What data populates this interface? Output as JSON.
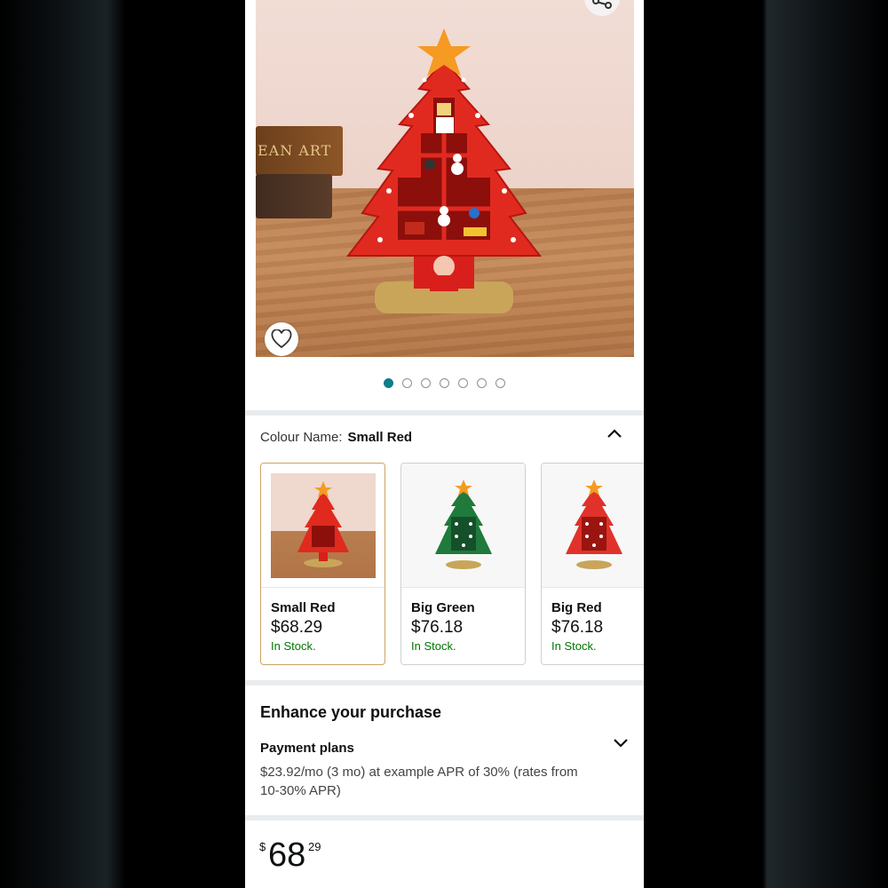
{
  "product_image": {
    "book_spine_text": "EAN ART",
    "share_icon": "share-icon",
    "wishlist_icon": "heart-icon"
  },
  "carousel": {
    "count": 7,
    "active_index": 0
  },
  "colour": {
    "label": "Colour Name:",
    "selected": "Small Red",
    "options": [
      {
        "name": "Small Red",
        "price": "$68.29",
        "stock": "In Stock."
      },
      {
        "name": "Big Green",
        "price": "$76.18",
        "stock": "In Stock."
      },
      {
        "name": "Big Red",
        "price": "$76.18",
        "stock": "In Stock."
      }
    ]
  },
  "enhance": {
    "title": "Enhance your purchase",
    "payment_title": "Payment plans",
    "payment_text": "$23.92/mo (3 mo) at example APR of 30% (rates from 10-30% APR)"
  },
  "price": {
    "currency": "$",
    "whole": "68",
    "fraction": "29"
  },
  "colors": {
    "accent": "#0f7d8a",
    "in_stock": "#007600",
    "selected_border": "#c8a464"
  }
}
